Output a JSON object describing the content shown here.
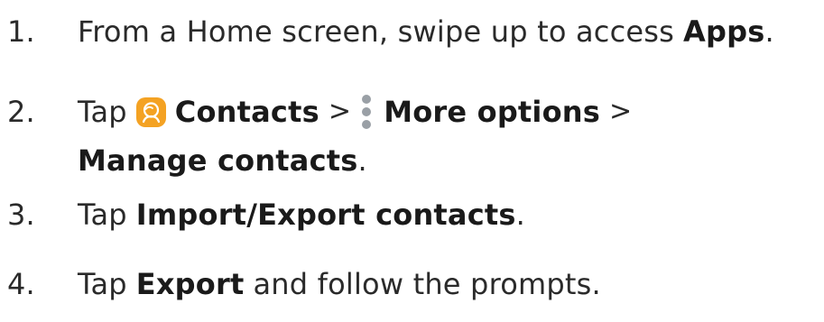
{
  "steps": [
    {
      "number": "1.",
      "parts": {
        "a": "From a Home screen, swipe up to access",
        "b": "Apps",
        "c": "."
      }
    },
    {
      "number": "2.",
      "parts": {
        "a": "Tap",
        "icon1": "contacts-app-icon",
        "b": "Contacts",
        "sep1": ">",
        "icon2": "more-options-icon",
        "c": "More options",
        "sep2": ">",
        "d": "Manage contacts",
        "e": "."
      }
    },
    {
      "number": "3.",
      "parts": {
        "a": "Tap",
        "b": "Import/Export contacts",
        "c": "."
      }
    },
    {
      "number": "4.",
      "parts": {
        "a": "Tap",
        "b": "Export",
        "c": "and follow the prompts."
      }
    }
  ],
  "colors": {
    "contacts_icon_bg": "#f4a223",
    "more_options_dots": "#9aa0a6",
    "text": "#2a2a2a"
  }
}
